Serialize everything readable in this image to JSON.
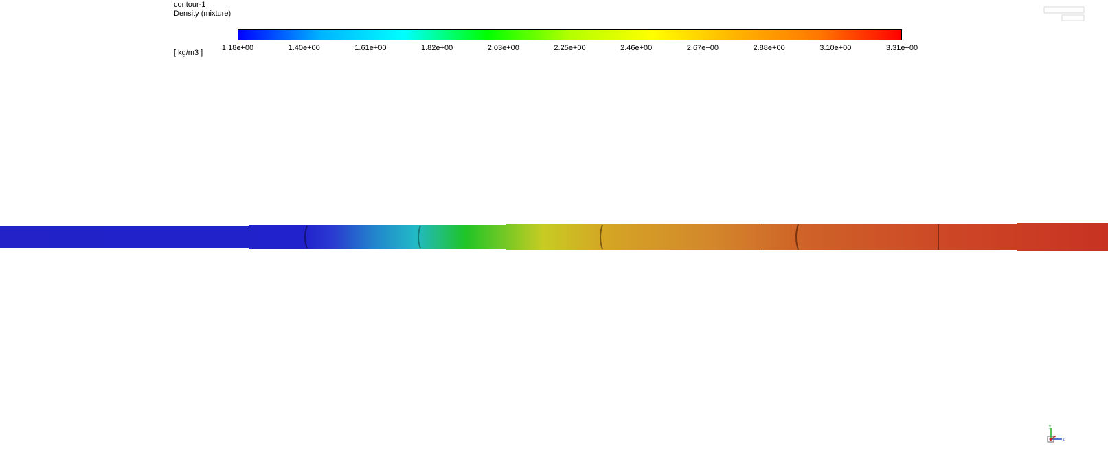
{
  "legend": {
    "title": "contour-1",
    "variable": "Density (mixture)",
    "units": "[ kg/m3 ]",
    "ticks": [
      "1.18e+00",
      "1.40e+00",
      "1.61e+00",
      "1.82e+00",
      "2.03e+00",
      "2.25e+00",
      "2.46e+00",
      "2.67e+00",
      "2.88e+00",
      "3.10e+00",
      "3.31e+00"
    ],
    "range": [
      1.18,
      3.31
    ],
    "colormap": [
      "#0000ff",
      "#00b4ff",
      "#00ffff",
      "#00ff00",
      "#b4ff00",
      "#ffff00",
      "#ffb400",
      "#ff7800",
      "#ff0000"
    ]
  },
  "geometry_colors": {
    "inlet": "#2222cc",
    "mid": "#1fc427",
    "yellow": "#c7cc23",
    "orange": "#d3882b",
    "outlet": "#cc3322"
  },
  "triad": {
    "axis_y": "y",
    "axis_z": "z"
  }
}
